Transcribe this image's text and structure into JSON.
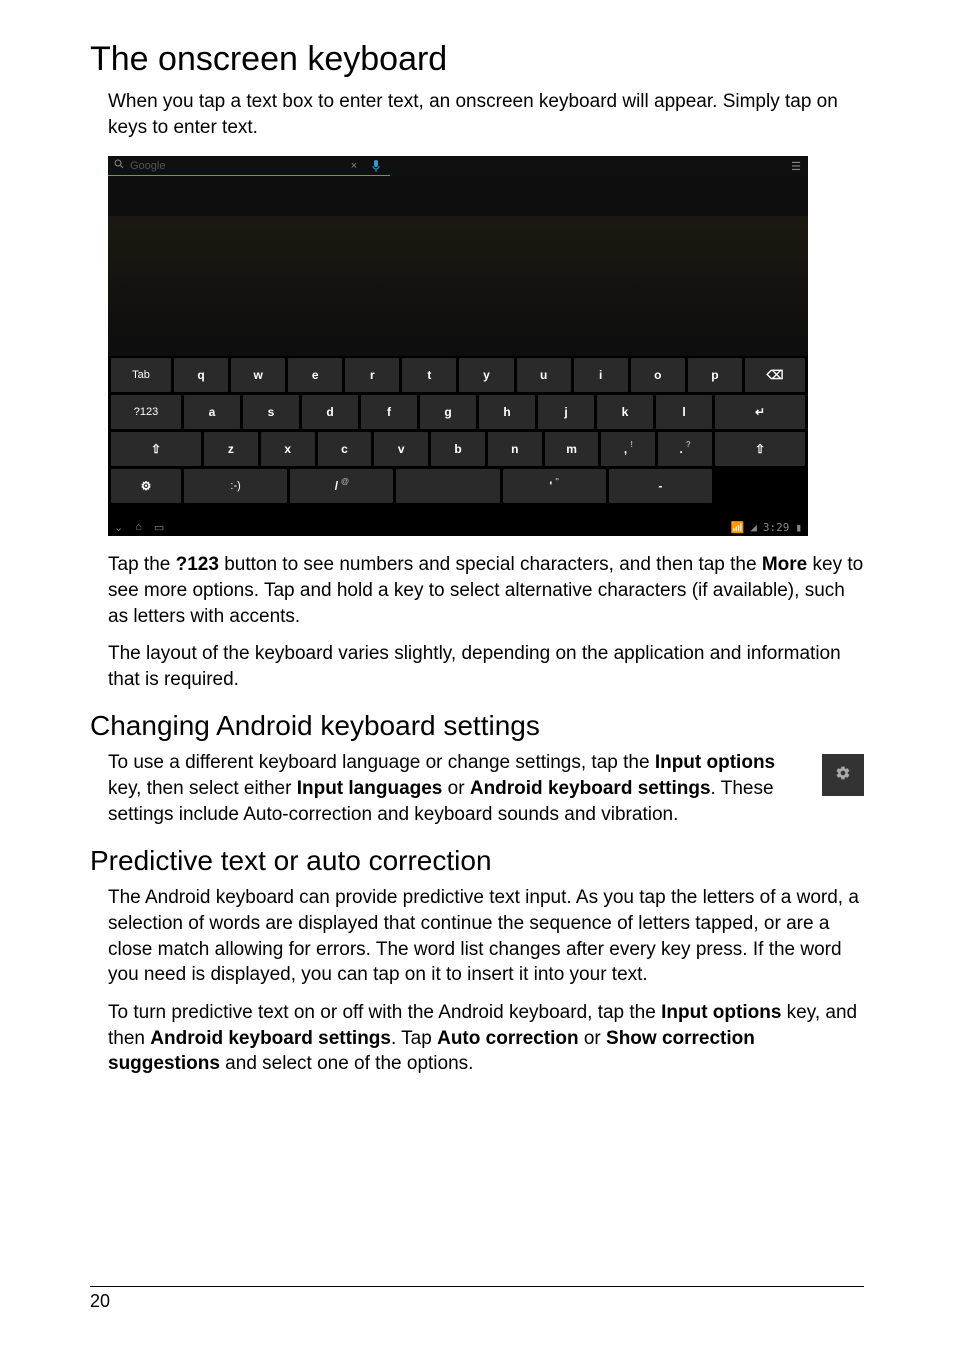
{
  "headings": {
    "h1": "The onscreen keyboard",
    "h2_changing": "Changing Android keyboard settings",
    "h2_predictive": "Predictive text or auto correction"
  },
  "paragraphs": {
    "intro": "When you tap a text box to enter text, an onscreen keyboard will appear. Simply tap on keys to enter text.",
    "tap123_a": "Tap the ",
    "tap123_b": " button to see numbers and special characters, and then tap the ",
    "tap123_c": " key to see more options. Tap and hold a key to select alternative characters (if available), such as letters with accents.",
    "layout": "The layout of the keyboard varies slightly, depending on the application and information that is required.",
    "changing_a": "To use a different keyboard language or change settings, tap the ",
    "changing_b": " key, then select either ",
    "changing_c": " or ",
    "changing_d": ". These settings include Auto-correction and keyboard sounds and vibration.",
    "pred1": "The Android keyboard can provide predictive text input. As you tap the letters of a word, a selection of words are displayed that continue the sequence of letters tapped, or are a close match allowing for errors. The word list changes after every key press. If the word you need is displayed, you can tap on it to insert it into your text.",
    "pred2_a": "To turn predictive text on or off with the Android keyboard, tap the ",
    "pred2_b": " key, and then ",
    "pred2_c": ". Tap ",
    "pred2_d": " or ",
    "pred2_e": " and select one of the options."
  },
  "bold": {
    "b_123": "?123",
    "b_more": "More",
    "b_input_options": "Input options",
    "b_input_languages": "Input languages",
    "b_android_kb_settings": "Android keyboard settings",
    "b_auto_correction": "Auto correction",
    "b_show_suggestions": "Show correction suggestions"
  },
  "screenshot": {
    "search_placeholder": "Google",
    "keyboard": {
      "row1": [
        "Tab",
        "q",
        "w",
        "e",
        "r",
        "t",
        "y",
        "u",
        "i",
        "o",
        "p",
        "⌫"
      ],
      "row2": [
        "?123",
        "a",
        "s",
        "d",
        "f",
        "g",
        "h",
        "j",
        "k",
        "l",
        "↵"
      ],
      "row3": [
        "⇧",
        "z",
        "x",
        "c",
        "v",
        "b",
        "n",
        "m",
        ",",
        ".",
        "⇧"
      ],
      "row4": [
        "⚙",
        ":-)",
        "/",
        "space",
        "'",
        "-"
      ]
    },
    "statusbar": {
      "time": "3:29"
    }
  },
  "page_number": "20"
}
